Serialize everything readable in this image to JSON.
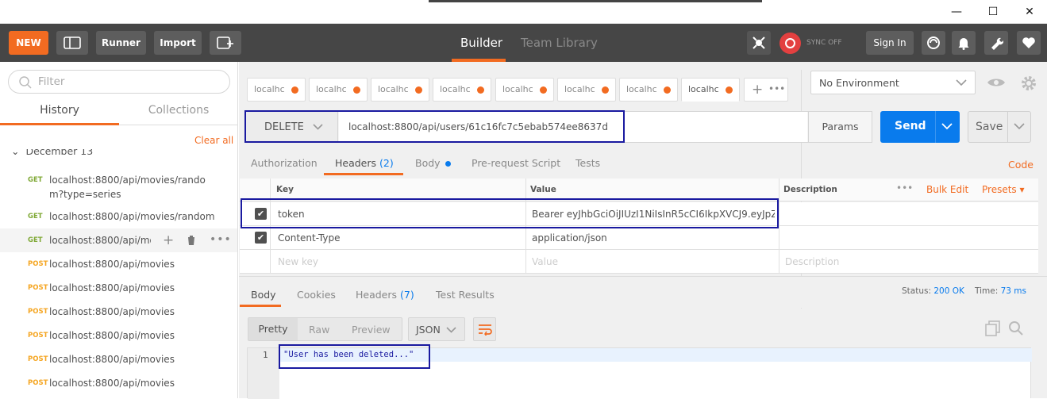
{
  "window": {
    "minimize": "—",
    "maximize": "☐",
    "close": "✕"
  },
  "toolbar": {
    "new_label": "NEW",
    "runner_label": "Runner",
    "import_label": "Import",
    "builder_tab": "Builder",
    "team_library_tab": "Team Library",
    "sync_status": "SYNC OFF",
    "signin_label": "Sign In"
  },
  "sidebar": {
    "filter_placeholder": "Filter",
    "tabs": [
      "History",
      "Collections"
    ],
    "clear_all": "Clear all",
    "group_date": "December 13",
    "items": [
      {
        "method": "GET",
        "url_line1": "localhost:8800/api/movies/rando",
        "url_line2": "m?type=series"
      },
      {
        "method": "GET",
        "url": "localhost:8800/api/movies/random"
      },
      {
        "method": "GET",
        "url": "localhost:8800/api/mov"
      },
      {
        "method": "POST",
        "url": "localhost:8800/api/movies"
      },
      {
        "method": "POST",
        "url": "localhost:8800/api/movies"
      },
      {
        "method": "POST",
        "url": "localhost:8800/api/movies"
      },
      {
        "method": "POST",
        "url": "localhost:8800/api/movies"
      },
      {
        "method": "POST",
        "url": "localhost:8800/api/movies"
      },
      {
        "method": "POST",
        "url": "localhost:8800/api/movies"
      }
    ]
  },
  "request_tabs": [
    "localhc",
    "localhc",
    "localhc",
    "localhc",
    "localhc",
    "localhc",
    "localhc",
    "localhc"
  ],
  "environment": {
    "selected": "No Environment"
  },
  "request": {
    "method": "DELETE",
    "url": "localhost:8800/api/users/61c16fc7c5ebab574ee8637d",
    "params_label": "Params",
    "send_label": "Send",
    "save_label": "Save"
  },
  "request_subtabs": {
    "authorization": "Authorization",
    "headers": "Headers",
    "headers_count": "(2)",
    "body": "Body",
    "prerequest": "Pre-request Script",
    "tests": "Tests",
    "code": "Code"
  },
  "headers_table": {
    "columns": {
      "key": "Key",
      "value": "Value",
      "description": "Description"
    },
    "bulk_edit": "Bulk Edit",
    "presets": "Presets",
    "rows": [
      {
        "key": "token",
        "value": "Bearer eyJhbGciOiJIUzI1NiIsInR5cCI6IkpXVCJ9.eyJpZC..."
      },
      {
        "key": "Content-Type",
        "value": "application/json"
      }
    ],
    "new_key_placeholder": "New key",
    "value_placeholder": "Value",
    "description_placeholder": "Description"
  },
  "response": {
    "tabs": {
      "body": "Body",
      "cookies": "Cookies",
      "headers": "Headers",
      "headers_count": "(7)",
      "test_results": "Test Results"
    },
    "status_label": "Status:",
    "status_value": "200 OK",
    "time_label": "Time:",
    "time_value": "73 ms",
    "view_modes": [
      "Pretty",
      "Raw",
      "Preview"
    ],
    "format": "JSON",
    "line_number": "1",
    "body_text": "\"User has been deleted...\""
  },
  "colors": {
    "accent": "#f26b21",
    "send": "#097bed",
    "highlight": "#1a1aa0"
  }
}
